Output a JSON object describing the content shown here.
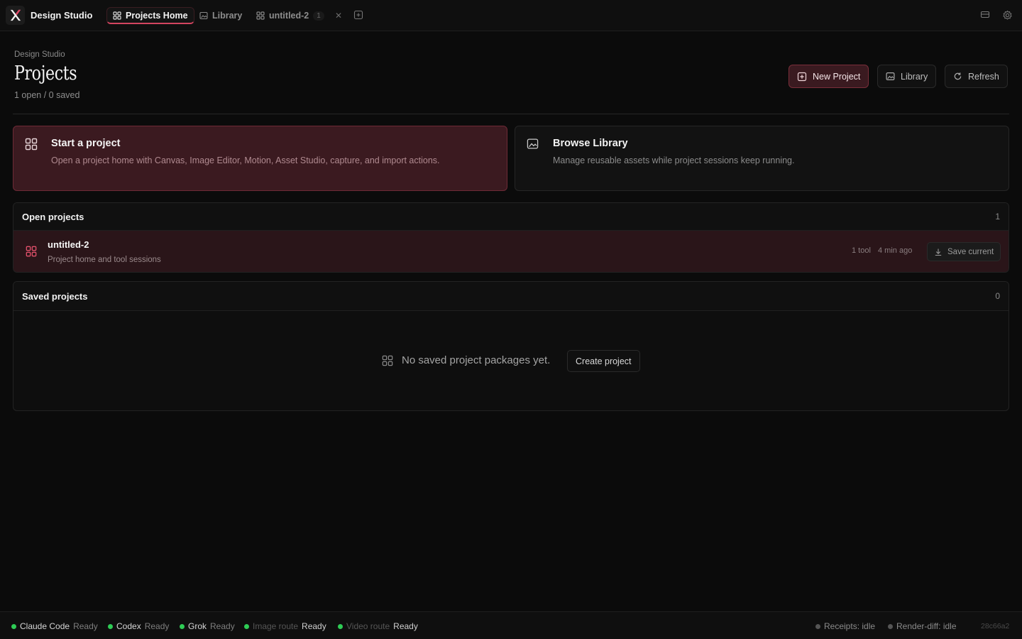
{
  "app": {
    "title": "Design Studio"
  },
  "tabs": [
    {
      "label": "Projects Home",
      "icon": "grid-icon",
      "active": true
    },
    {
      "label": "Library",
      "icon": "image-icon",
      "active": false
    },
    {
      "label": "untitled-2",
      "icon": "grid-icon",
      "active": false,
      "count": "1"
    }
  ],
  "header": {
    "breadcrumb": "Design Studio",
    "title": "Projects",
    "subtitle": "1 open / 0 saved",
    "buttons": {
      "new_project": "New Project",
      "library": "Library",
      "refresh": "Refresh"
    }
  },
  "cards": [
    {
      "title": "Start a project",
      "description": "Open a project home with Canvas, Image Editor, Motion, Asset Studio, capture, and import actions.",
      "icon": "grid-icon"
    },
    {
      "title": "Browse Library",
      "description": "Manage reusable assets while project sessions keep running.",
      "icon": "image-icon"
    }
  ],
  "open_projects": {
    "title": "Open projects",
    "count": "1",
    "items": [
      {
        "name": "untitled-2",
        "subtitle": "Project home and tool sessions",
        "tools": "1 tool",
        "time": "4 min ago",
        "action": "Save current"
      }
    ]
  },
  "saved_projects": {
    "title": "Saved projects",
    "count": "0",
    "empty_text": "No saved project packages yet.",
    "empty_action": "Create project"
  },
  "status": {
    "left": [
      {
        "name": "Claude Code",
        "value": "Ready"
      },
      {
        "name": "Codex",
        "value": "Ready"
      },
      {
        "name": "Grok",
        "value": "Ready"
      },
      {
        "name": "Image route",
        "value": "Ready"
      },
      {
        "name": "Video route",
        "value": "Ready"
      }
    ],
    "receipts": "Receipts: idle",
    "render_diff": "Render-diff: idle",
    "hash": "28c66a2"
  },
  "colors": {
    "accent": "#d44560",
    "ready": "#2ecc55",
    "background": "#0b0b0b"
  }
}
